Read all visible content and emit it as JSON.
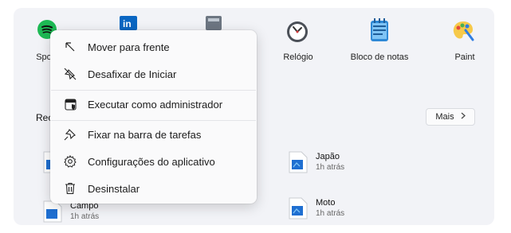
{
  "pinned_apps": [
    {
      "label": "Spo",
      "icon": "spotify-icon"
    },
    {
      "label": "",
      "icon": "linkedin-icon"
    },
    {
      "label": "",
      "icon": "calculator-icon"
    },
    {
      "label": "Relógio",
      "icon": "clock-icon"
    },
    {
      "label": "Bloco de notas",
      "icon": "notepad-icon"
    },
    {
      "label": "Paint",
      "icon": "paint-icon"
    }
  ],
  "recommended": {
    "title": "Rec",
    "more_label": "Mais",
    "items": [
      {
        "name": "",
        "time": ""
      },
      {
        "name": "Japão",
        "time": "1h atrás"
      },
      {
        "name": "Campo",
        "time": "1h atrás"
      },
      {
        "name": "Moto",
        "time": "1h atrás"
      }
    ]
  },
  "context_menu": {
    "items": [
      {
        "label": "Mover para frente",
        "icon": "arrow-up-left-icon"
      },
      {
        "label": "Desafixar de Iniciar",
        "icon": "unpin-icon"
      },
      {
        "label": "Executar como administrador",
        "icon": "admin-shield-icon"
      },
      {
        "label": "Fixar na barra de tarefas",
        "icon": "pin-icon"
      },
      {
        "label": "Configurações do aplicativo",
        "icon": "gear-icon"
      },
      {
        "label": "Desinstalar",
        "icon": "trash-icon"
      }
    ]
  },
  "colors": {
    "panel_bg": "#f2f3f7",
    "menu_bg": "#fafafb",
    "spotify": "#1db954",
    "linkedin": "#0a66c2",
    "file_blue": "#1f6fd1"
  }
}
